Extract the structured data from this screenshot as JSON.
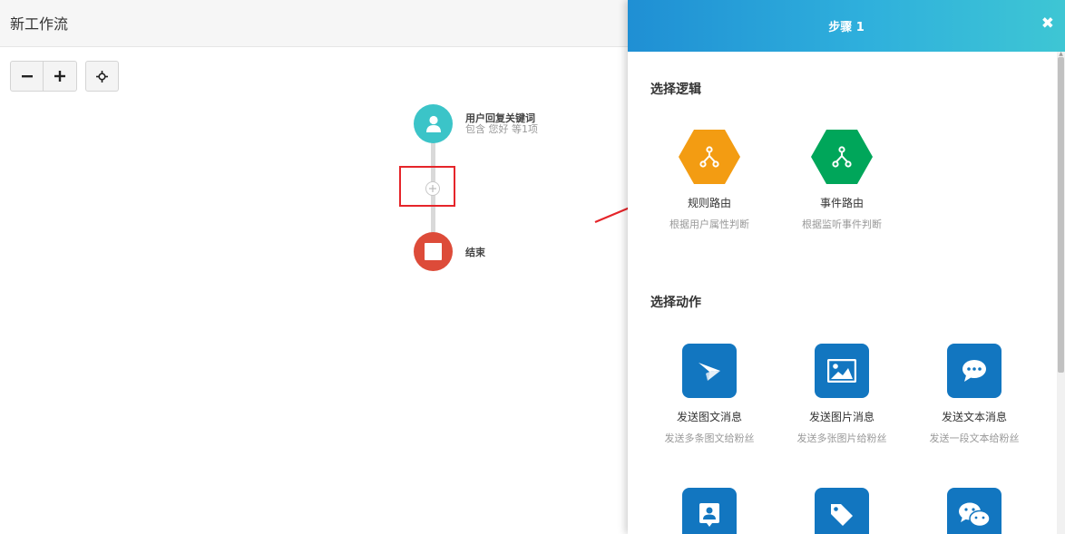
{
  "canvas": {
    "title": "新工作流",
    "toolbar": {
      "zoom_out_icon": "minus-icon",
      "zoom_in_icon": "plus-icon",
      "center_icon": "crosshair-icon"
    },
    "nodes": {
      "start": {
        "title": "用户回复关键词",
        "subtitle": "包含 您好 等1项",
        "icon": "user-icon",
        "color": "#3bc4c8"
      },
      "end": {
        "title": "结束",
        "icon": "stop-icon",
        "color": "#dd4b39"
      }
    },
    "annotation_color": "#e5252a"
  },
  "panel": {
    "title": "步骤 1",
    "close_icon": "close-icon",
    "logic_section": {
      "title": "选择逻辑",
      "cards": [
        {
          "label": "规则路由",
          "desc": "根据用户属性判断",
          "icon": "branch-icon",
          "color": "#f39c12"
        },
        {
          "label": "事件路由",
          "desc": "根据监听事件判断",
          "icon": "branch-icon",
          "color": "#00a65a"
        }
      ]
    },
    "action_section": {
      "title": "选择动作",
      "cards": [
        {
          "label": "发送图文消息",
          "desc": "发送多条图文给粉丝",
          "icon": "paper-plane-icon",
          "color": "#1276c0"
        },
        {
          "label": "发送图片消息",
          "desc": "发送多张图片给粉丝",
          "icon": "image-icon",
          "color": "#1276c0"
        },
        {
          "label": "发送文本消息",
          "desc": "发送一段文本给粉丝",
          "icon": "comment-icon",
          "color": "#1276c0"
        },
        {
          "label": "",
          "desc": "",
          "icon": "contact-card-icon",
          "color": "#1276c0"
        },
        {
          "label": "",
          "desc": "",
          "icon": "tag-icon",
          "color": "#1276c0"
        },
        {
          "label": "",
          "desc": "",
          "icon": "wechat-icon",
          "color": "#1276c0"
        }
      ]
    }
  }
}
